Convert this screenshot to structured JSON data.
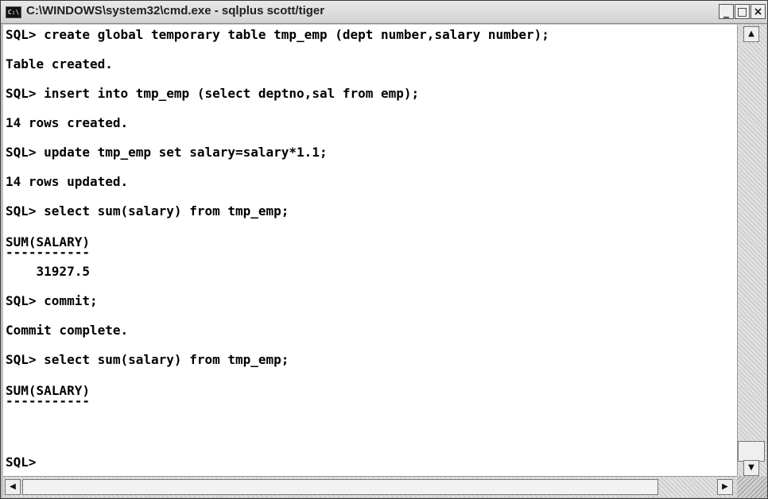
{
  "window": {
    "title": "C:\\WINDOWS\\system32\\cmd.exe - sqlplus scott/tiger",
    "icon": "cmd-icon",
    "icon_text": "C:\\",
    "buttons": {
      "minimize": "_",
      "maximize": "□",
      "close": "×"
    }
  },
  "console": {
    "lines": [
      "SQL> create global temporary table tmp_emp (dept number,salary number);",
      "Table created.",
      "SQL> insert into tmp_emp (select deptno,sal from emp);",
      "14 rows created.",
      "SQL> update tmp_emp set salary=salary*1.1;",
      "14 rows updated.",
      "SQL> select sum(salary) from tmp_emp;",
      "SUM(SALARY)",
      "-----------",
      "    31927.5",
      "SQL> commit;",
      "Commit complete.",
      "SQL> select sum(salary) from tmp_emp;",
      "SUM(SALARY)",
      "-----------",
      "SQL>"
    ]
  },
  "scrollbars": {
    "up_arrow": "▲",
    "down_arrow": "▼",
    "left_arrow": "◀",
    "right_arrow": "▶"
  }
}
